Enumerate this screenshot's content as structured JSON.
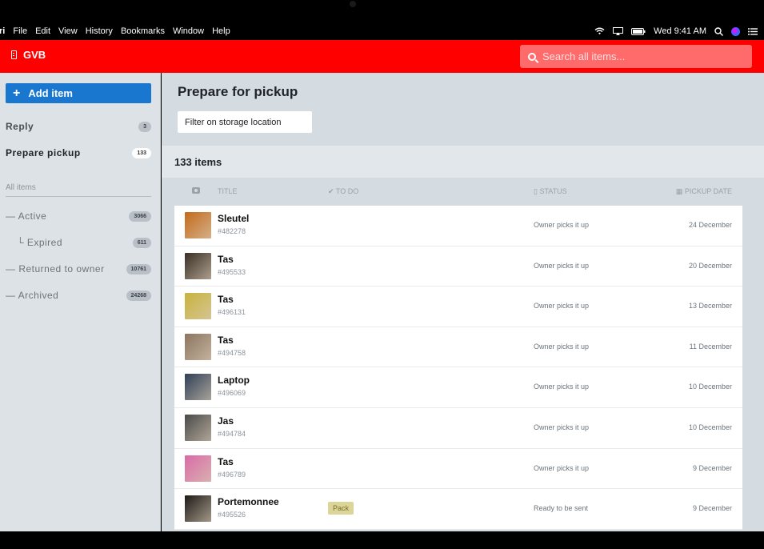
{
  "menubar": {
    "app": "ri",
    "items": [
      "File",
      "Edit",
      "View",
      "History",
      "Bookmarks",
      "Window",
      "Help"
    ],
    "clock": "Wed 9:41 AM"
  },
  "header": {
    "brand": "GVB",
    "search_placeholder": "Search all items..."
  },
  "sidebar": {
    "add_label": "Add item",
    "nav": [
      {
        "label": "Reply",
        "count": "3"
      },
      {
        "label": "Prepare pickup",
        "count": "133"
      }
    ],
    "all_items_heading": "All items",
    "filters": [
      {
        "label": "— Active",
        "count": "3066"
      },
      {
        "label": "└ Expired",
        "count": "611"
      },
      {
        "label": "— Returned to owner",
        "count": "10761"
      },
      {
        "label": "— Archived",
        "count": "24268"
      }
    ]
  },
  "main": {
    "title": "Prepare for pickup",
    "filter_label": "Filter on storage location",
    "count_label": "133 items",
    "columns": {
      "title": "TITLE",
      "todo": "✔ TO DO",
      "status": "▯ STATUS",
      "date": "▦ PICKUP DATE"
    },
    "rows": [
      {
        "title": "Sleutel",
        "id": "#482278",
        "todo": "",
        "status": "Owner picks it up",
        "date": "24 December",
        "thumb": "#c46a1a"
      },
      {
        "title": "Tas",
        "id": "#495533",
        "todo": "",
        "status": "Owner picks it up",
        "date": "20 December",
        "thumb": "#3a2f26"
      },
      {
        "title": "Tas",
        "id": "#496131",
        "todo": "",
        "status": "Owner picks it up",
        "date": "13 December",
        "thumb": "#c9b33d"
      },
      {
        "title": "Tas",
        "id": "#494758",
        "todo": "",
        "status": "Owner picks it up",
        "date": "11 December",
        "thumb": "#8c7560"
      },
      {
        "title": "Laptop",
        "id": "#496069",
        "todo": "",
        "status": "Owner picks it up",
        "date": "10 December",
        "thumb": "#2f3f56"
      },
      {
        "title": "Jas",
        "id": "#494784",
        "todo": "",
        "status": "Owner picks it up",
        "date": "10 December",
        "thumb": "#4a4a4a"
      },
      {
        "title": "Tas",
        "id": "#496789",
        "todo": "",
        "status": "Owner picks it up",
        "date": "9 December",
        "thumb": "#d96ba6"
      },
      {
        "title": "Portemonnee",
        "id": "#495526",
        "todo": "Pack",
        "status": "Ready to be sent",
        "date": "9 December",
        "thumb": "#1d1a18"
      }
    ]
  }
}
